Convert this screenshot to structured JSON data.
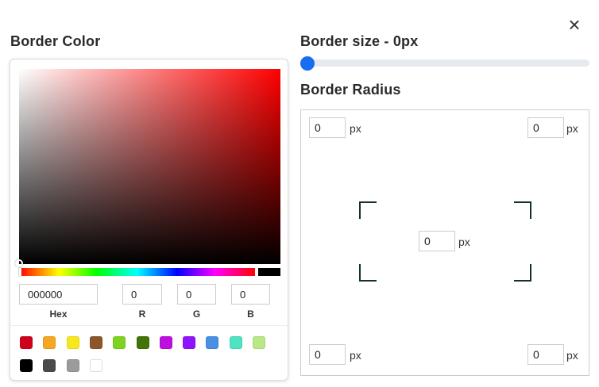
{
  "close_icon": "×",
  "border_color": {
    "title": "Border Color",
    "hex": {
      "value": "000000",
      "label": "Hex"
    },
    "r": {
      "value": "0",
      "label": "R"
    },
    "g": {
      "value": "0",
      "label": "G"
    },
    "b": {
      "value": "0",
      "label": "B"
    },
    "selected_color": "#000000",
    "hue_color": "#ff0000",
    "swatches": [
      "#d0021b",
      "#f5a623",
      "#f8e71c",
      "#8b572a",
      "#7ed321",
      "#417505",
      "#bd10e0",
      "#9013fe",
      "#4a90e2",
      "#50e3c2",
      "#b8e986",
      "#000000",
      "#4a4a4a",
      "#9b9b9b",
      "#ffffff"
    ]
  },
  "border_size": {
    "title": "Border size - 0px",
    "value": 0
  },
  "border_radius": {
    "title": "Border Radius",
    "unit": "px",
    "top_left": "0",
    "top_right": "0",
    "all": "0",
    "bottom_left": "0",
    "bottom_right": "0"
  }
}
